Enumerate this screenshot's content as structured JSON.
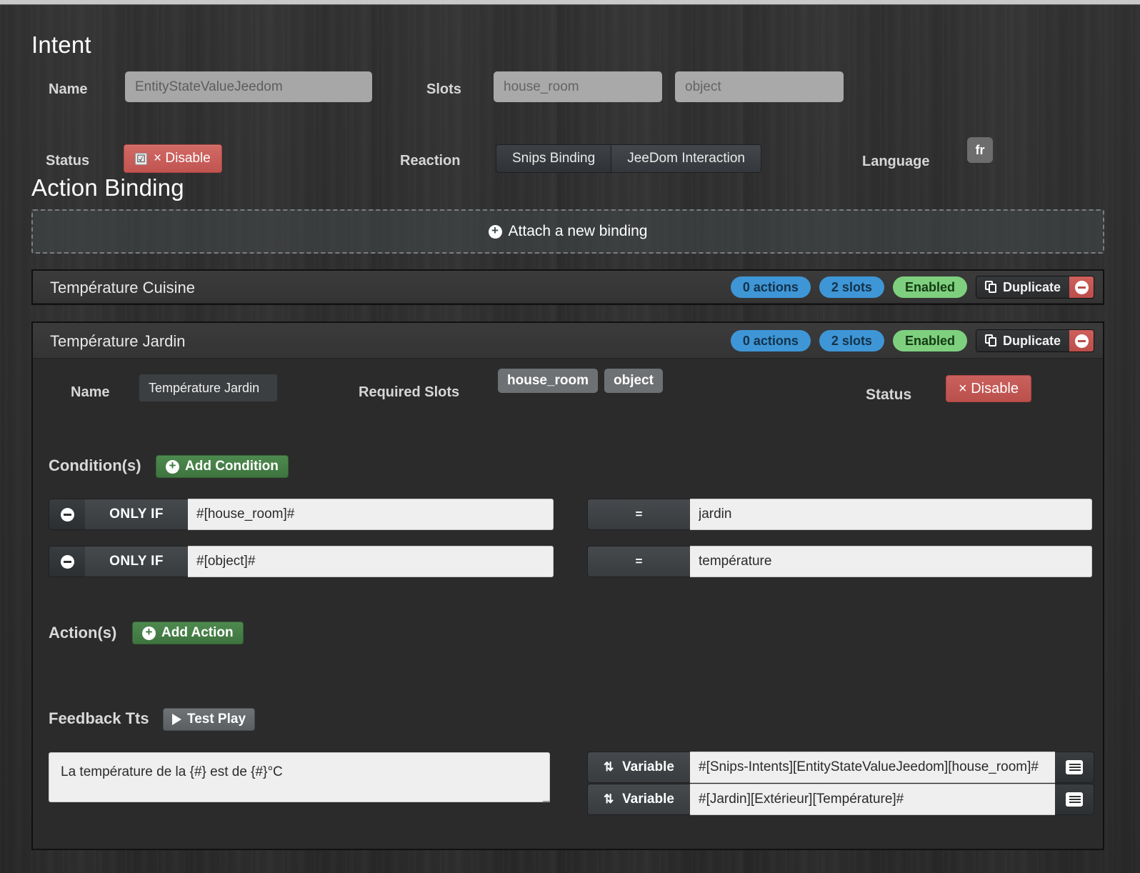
{
  "intent": {
    "heading": "Intent",
    "name_label": "Name",
    "name_value": "EntityStateValueJeedom",
    "slots_label": "Slots",
    "slots": [
      "house_room",
      "object"
    ],
    "status_label": "Status",
    "status_button": "× Disable",
    "status_checked": "☑",
    "reaction_label": "Reaction",
    "reaction_buttons": [
      "Snips Binding",
      "JeeDom Interaction"
    ],
    "language_label": "Language",
    "language_value": "fr"
  },
  "action_binding": {
    "heading": "Action Binding",
    "attach_label": "Attach a new binding",
    "plus_icon": "+",
    "bindings": [
      {
        "title": "Température Cuisine",
        "actions_badge": "0 actions",
        "slots_badge": "2 slots",
        "status_badge": "Enabled",
        "duplicate_label": "Duplicate"
      },
      {
        "title": "Température Jardin",
        "actions_badge": "0 actions",
        "slots_badge": "2 slots",
        "status_badge": "Enabled",
        "duplicate_label": "Duplicate"
      }
    ]
  },
  "binding_detail": {
    "name_label": "Name",
    "name_value": "Température Jardin",
    "required_slots_label": "Required Slots",
    "required_slots": [
      "house_room",
      "object"
    ],
    "status_label": "Status",
    "disable_button": "× Disable",
    "conditions_label": "Condition(s)",
    "add_condition_label": "Add Condition",
    "conditions": [
      {
        "prefix": "ONLY IF",
        "expression": "#[house_room]#",
        "operator": "=",
        "value": "jardin"
      },
      {
        "prefix": "ONLY IF",
        "expression": "#[object]#",
        "operator": "=",
        "value": "température"
      }
    ],
    "actions_label": "Action(s)",
    "add_action_label": "Add Action",
    "feedback_label": "Feedback Tts",
    "test_play_label": "Test Play",
    "feedback_text": "La température de la {#} est de {#}°C",
    "variables": [
      {
        "label": "Variable",
        "value": "#[Snips-Intents][EntityStateValueJeedom][house_room]#"
      },
      {
        "label": "Variable",
        "value": "#[Jardin][Extérieur][Température]#"
      }
    ]
  }
}
